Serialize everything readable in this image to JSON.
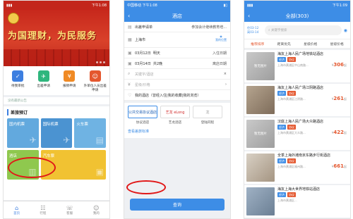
{
  "phone1": {
    "status_time": "下午1:08",
    "banner_slogan": "为国理财，为民服务",
    "quick": [
      {
        "label": "待我审批",
        "icon": "approve-icon",
        "color": "#3d7fe0"
      },
      {
        "label": "出差申请",
        "icon": "trip-icon",
        "color": "#2fb67d"
      },
      {
        "label": "报销申请",
        "icon": "expense-icon",
        "color": "#f08a24"
      },
      {
        "label": "外单位人员出差申请",
        "icon": "visitor-icon",
        "color": "#e4572e"
      }
    ],
    "notice": "没有最新公告",
    "section_title": "差旅预订",
    "tiles": [
      {
        "label": "国内机票",
        "icon": "✈"
      },
      {
        "label": "国际机票",
        "icon": "✈"
      },
      {
        "label": "火车票",
        "icon": "🚆"
      },
      {
        "label": "酒店",
        "icon": "🏨"
      },
      {
        "label": "汽车票",
        "icon": "🚌"
      }
    ],
    "tabs": [
      {
        "label": "首页",
        "icon": "⌂"
      },
      {
        "label": "行程",
        "icon": "☷"
      },
      {
        "label": "客服",
        "icon": "☏"
      },
      {
        "label": "我的",
        "icon": "☺"
      }
    ]
  },
  "phone2": {
    "status_time": "中国移动 下午1:08",
    "title": "酒店",
    "apply_label": "出差申请单",
    "apply_value": "参加会计继续教育培...",
    "city": "上海市",
    "my_location": "我的位置",
    "checkin": {
      "date": "03月12日",
      "day": "明天",
      "tag": "入住日期"
    },
    "checkout": {
      "date": "03月14日",
      "day": "共2晚",
      "tag": "离店日期"
    },
    "keyword_placeholder": "关键字/酒店",
    "star_price": "星级/价格",
    "my_hotels": "我的酒店（曾经入住|我的收藏|我的浏览）",
    "brands": [
      {
        "logo": "公共交易协议酒店",
        "label": "协议酒店"
      },
      {
        "logo": "艺龙 eLong",
        "label": "艺龙酒店"
      },
      {
        "logo": "龙",
        "label": "登陆同程"
      }
    ],
    "view_policy": "查看差旅标准",
    "search_button": "查询"
  },
  "phone3": {
    "status_time": "下午1:09",
    "title": "全部(303)",
    "dates": [
      "住03-12",
      "离03-14"
    ],
    "search_placeholder": "关键字搜索",
    "sort": [
      "推荐排序",
      "距离优先",
      "星级价格",
      "星级价格"
    ],
    "hotels": [
      {
        "name": "海友上海人民广场地铁站酒店",
        "badges": [
          "经济",
          "协议"
        ],
        "addr": "上海市黄浦区中山南路...",
        "price": "306",
        "thumb": "暂无图片"
      },
      {
        "name": "海友上海人民广场江阴路酒店",
        "badges": [
          "经济",
          "协议"
        ],
        "addr": "上海市黄浦区江阴路...",
        "price": "261",
        "thumb": ""
      },
      {
        "name": "汉庭上海人民广场大众路酒店",
        "badges": [
          "经济",
          "协议"
        ],
        "addr": "上海市黄浦区大众路...",
        "price": "422",
        "thumb": "暂无图片"
      },
      {
        "name": "全季上海外滩南京东路步行街酒店",
        "badges": [
          "经济",
          "协议"
        ],
        "addr": "上海市黄浦区福州路...",
        "price": "661",
        "thumb": ""
      },
      {
        "name": "海友上海大世界地铁站酒店",
        "badges": [
          "经济",
          "协议"
        ],
        "addr": "上海市黄浦区...",
        "price": "",
        "thumb": ""
      }
    ]
  }
}
